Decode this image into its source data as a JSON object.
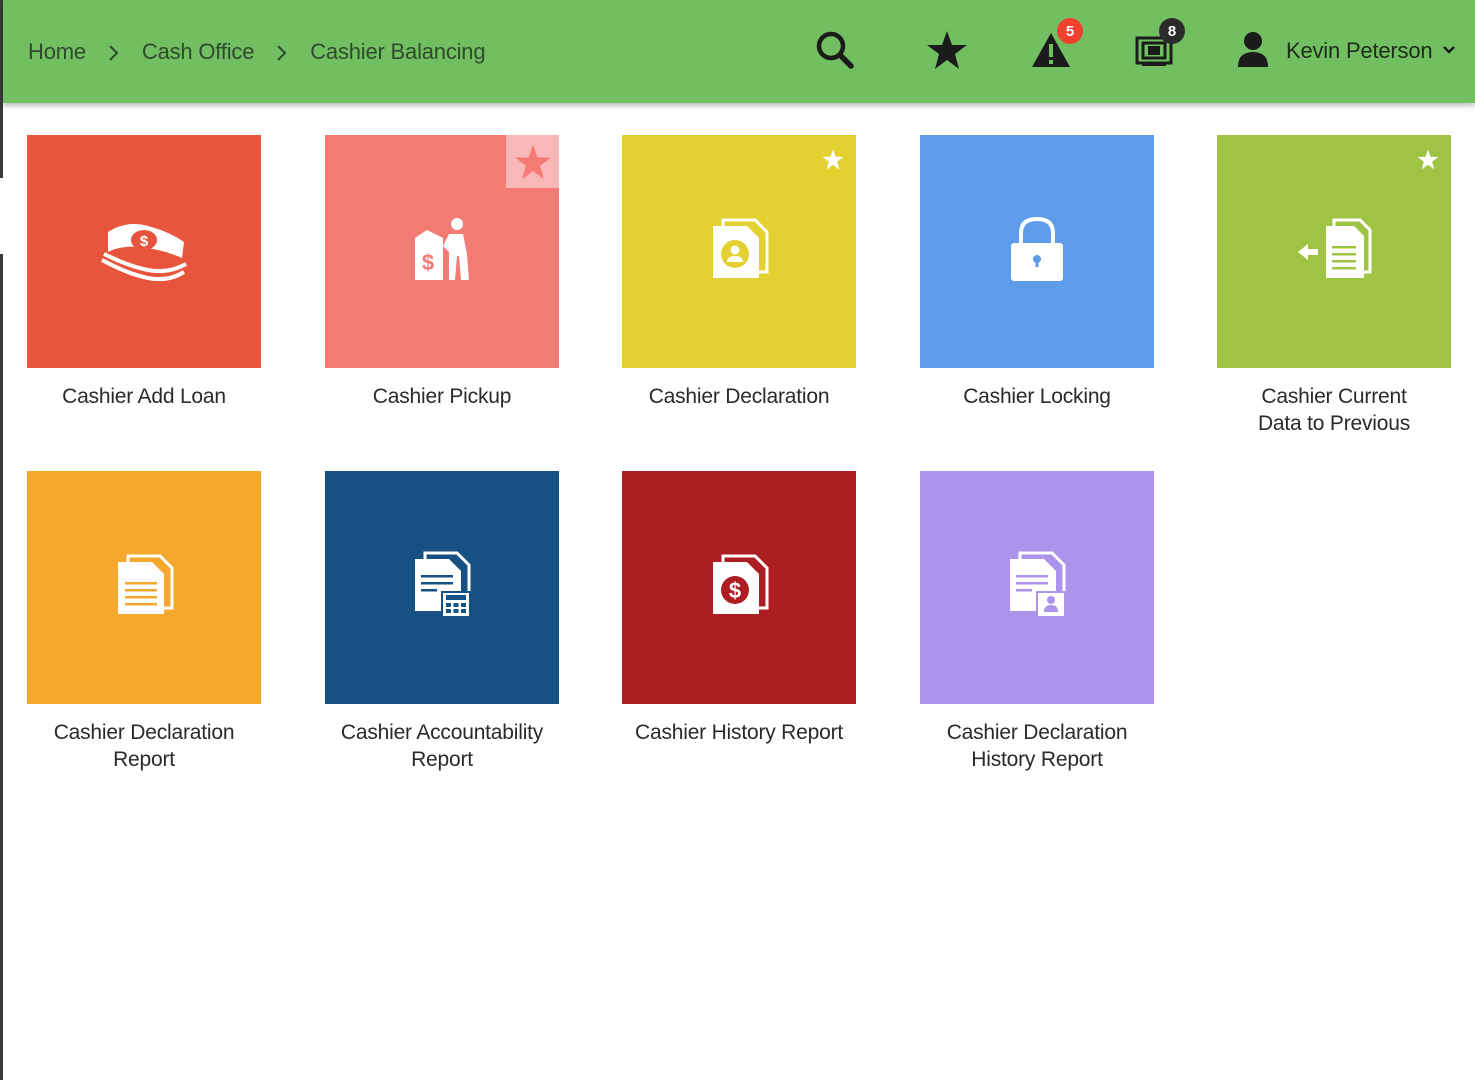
{
  "header": {
    "breadcrumb": [
      "Home",
      "Cash Office",
      "Cashier Balancing"
    ],
    "search_icon": "search-icon",
    "favorites_icon": "star-icon",
    "alerts_icon": "warning-icon",
    "alerts_count": "5",
    "screens_icon": "screens-icon",
    "screens_count": "8",
    "user_name": "Kevin Peterson",
    "colors": {
      "bar": "#72bf62",
      "alert_badge": "#f0402e",
      "screens_badge": "#2b2b2b"
    }
  },
  "tiles": [
    {
      "label_line1": "Cashier Add Loan",
      "label_line2": "",
      "icon": "money-stack-icon",
      "color": "#e8553d",
      "favorite": "none"
    },
    {
      "label_line1": "Cashier Pickup",
      "label_line2": "",
      "icon": "cash-pickup-icon",
      "color": "#f47a74",
      "favorite": "highlighted"
    },
    {
      "label_line1": "Cashier Declaration",
      "label_line2": "",
      "icon": "user-document-icon",
      "color": "#e3d132",
      "favorite": "starred"
    },
    {
      "label_line1": "Cashier Locking",
      "label_line2": "",
      "icon": "lock-icon",
      "color": "#5e9ce9",
      "favorite": "none"
    },
    {
      "label_line1": "Cashier Current",
      "label_line2": "Data to Previous",
      "icon": "document-back-arrow-icon",
      "color": "#9fc443",
      "favorite": "starred"
    },
    {
      "label_line1": "Cashier Declaration",
      "label_line2": "Report",
      "icon": "document-icon",
      "color": "#f4a82e",
      "favorite": "none"
    },
    {
      "label_line1": "Cashier Accountability",
      "label_line2": "Report",
      "icon": "document-calculator-icon",
      "color": "#175183",
      "favorite": "none"
    },
    {
      "label_line1": "Cashier History Report",
      "label_line2": "",
      "icon": "dollar-document-icon",
      "color": "#ad1e23",
      "favorite": "none"
    },
    {
      "label_line1": "Cashier Declaration",
      "label_line2": "History Report",
      "icon": "document-user-icon",
      "color": "#ac94ea",
      "favorite": "none"
    }
  ]
}
